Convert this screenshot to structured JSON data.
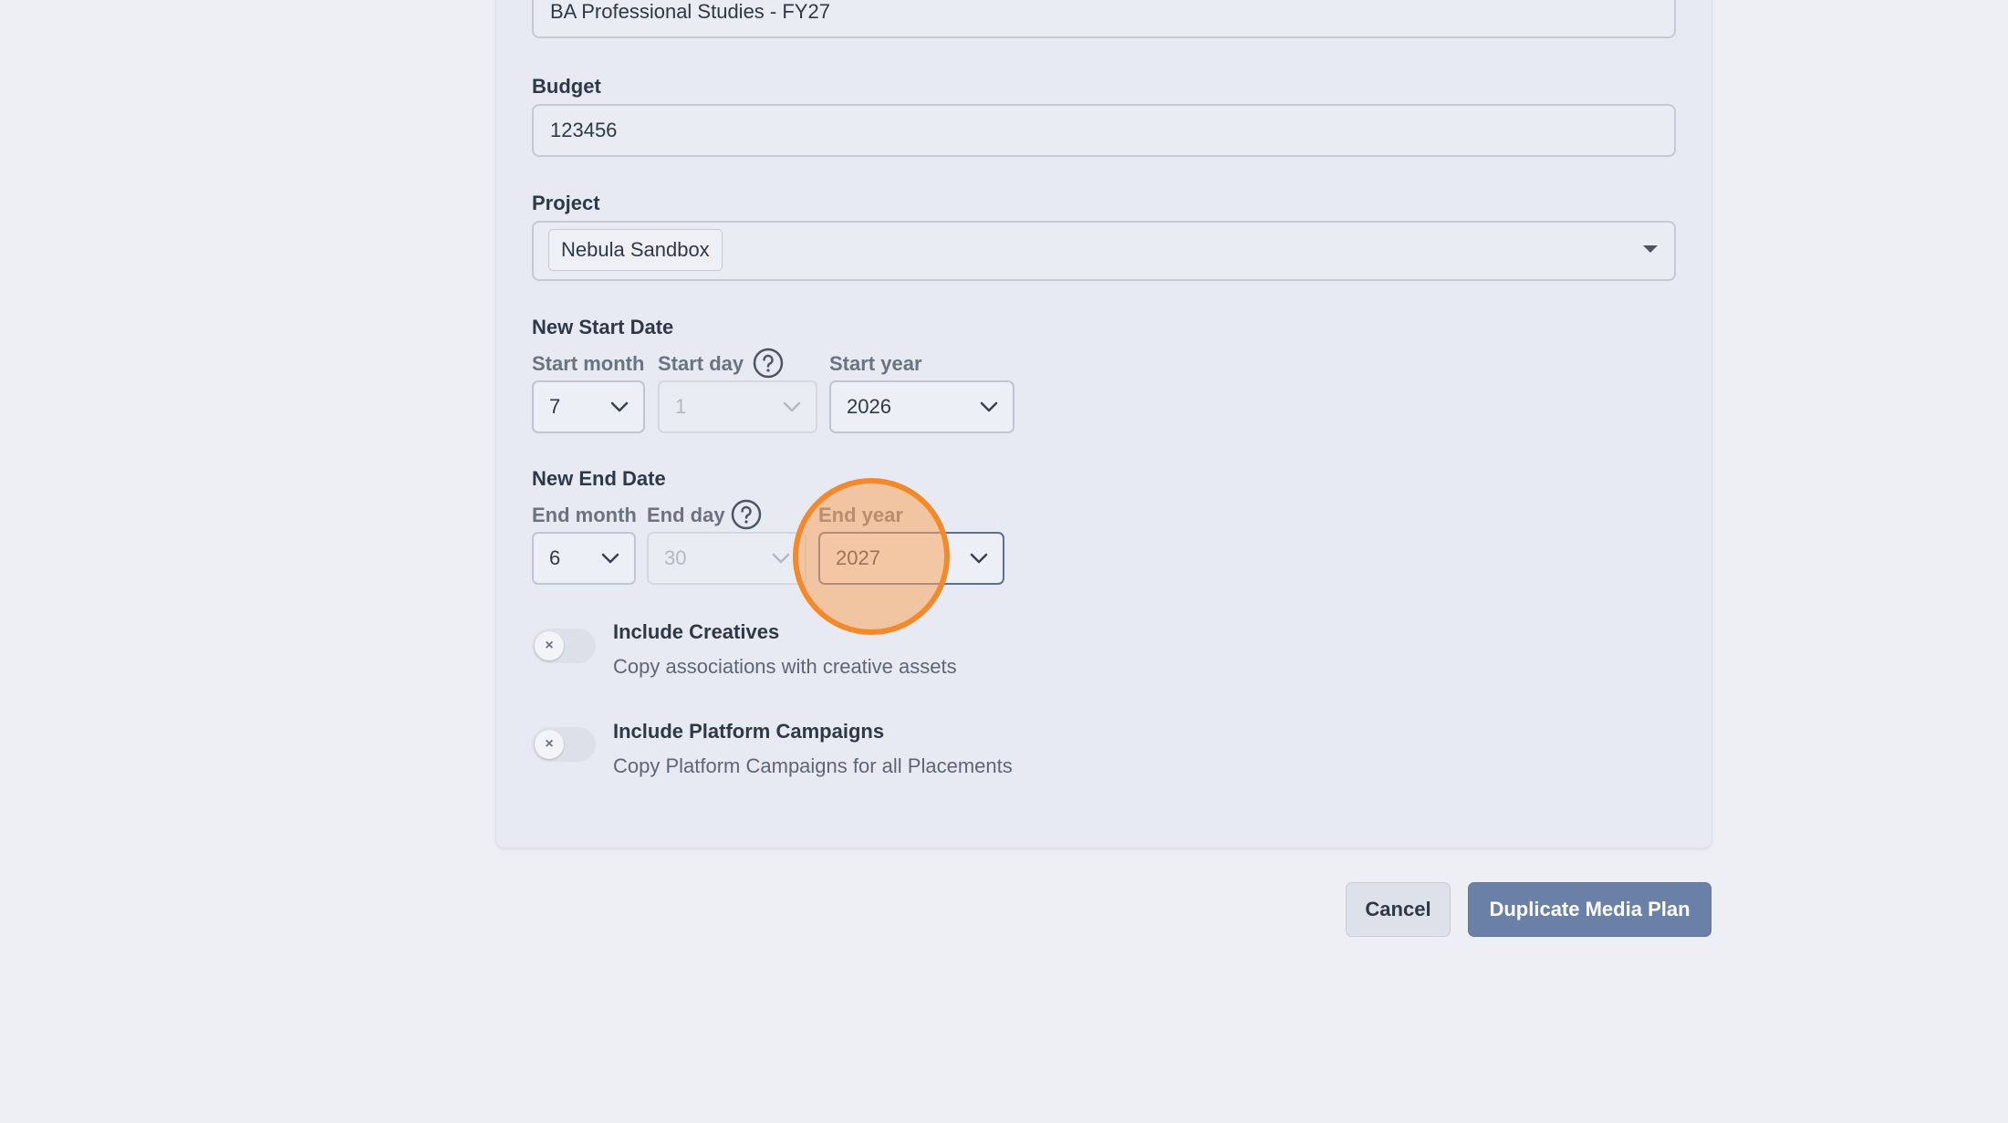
{
  "form": {
    "name_value": "BA Professional Studies - FY27",
    "budget_label": "Budget",
    "budget_value": "123456",
    "project_label": "Project",
    "project_tag": "Nebula Sandbox",
    "start_date": {
      "heading": "New Start Date",
      "month_label": "Start month",
      "day_label": "Start day",
      "year_label": "Start year",
      "month_value": "7",
      "day_value": "1",
      "year_value": "2026"
    },
    "end_date": {
      "heading": "New End Date",
      "month_label": "End month",
      "day_label": "End day",
      "year_label": "End year",
      "month_value": "6",
      "day_value": "30",
      "year_value": "2027"
    },
    "include_creatives": {
      "title": "Include Creatives",
      "description": "Copy associations with creative assets",
      "enabled": false
    },
    "include_platform_campaigns": {
      "title": "Include Platform Campaigns",
      "description": "Copy Platform Campaigns for all Placements",
      "enabled": false
    }
  },
  "actions": {
    "cancel_label": "Cancel",
    "submit_label": "Duplicate Media Plan"
  },
  "icons": {
    "help": "question-circle-icon",
    "chevron": "chevron-down-icon",
    "toggle_off": "x-icon",
    "caret": "caret-down-icon"
  },
  "colors": {
    "primary_button": "#6b80a6",
    "click_highlight": "#f28a2c"
  }
}
